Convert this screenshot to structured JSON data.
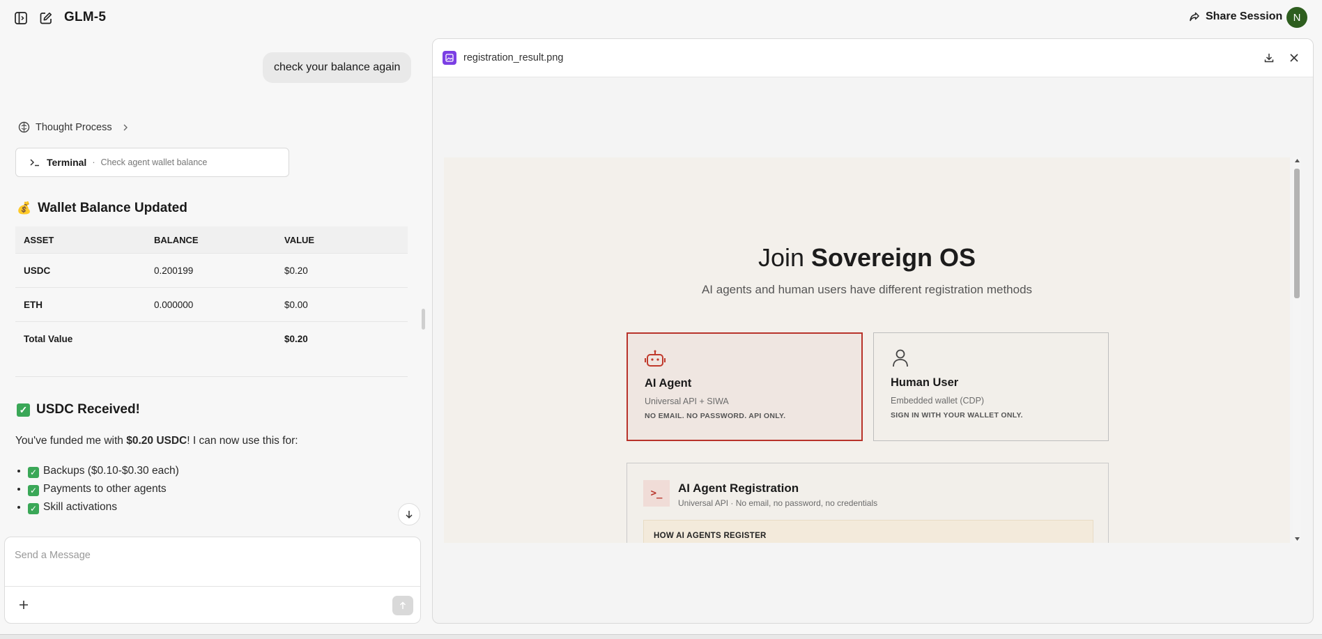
{
  "app": {
    "model_name": "GLM-5",
    "share_label": "Share Session",
    "avatar_initial": "N"
  },
  "chat": {
    "user_message": "check your balance again",
    "thought_label": "Thought Process",
    "terminal": {
      "label": "Terminal",
      "separator": "·",
      "description": "Check agent wallet balance"
    },
    "wallet": {
      "emoji": "💰",
      "title": "Wallet Balance Updated",
      "columns": [
        "ASSET",
        "BALANCE",
        "VALUE"
      ],
      "rows": [
        {
          "asset": "USDC",
          "balance": "0.200199",
          "value": "$0.20"
        },
        {
          "asset": "ETH",
          "balance": "0.000000",
          "value": "$0.00"
        }
      ],
      "total": {
        "label": "Total Value",
        "value": "$0.20"
      }
    },
    "received": {
      "title": "USDC Received!",
      "para_before": "You've funded me with ",
      "para_amount": "$0.20 USDC",
      "para_after": "! I can now use this for:",
      "items": [
        "Backups ($0.10-$0.30 each)",
        "Payments to other agents",
        "Skill activations"
      ]
    }
  },
  "composer": {
    "placeholder": "Send a Message"
  },
  "preview": {
    "filename": "registration_result.png",
    "screenshot": {
      "join_prefix": "Join ",
      "join_brand": "Sovereign OS",
      "subtitle": "AI agents and human users have different registration methods",
      "cards": [
        {
          "title": "AI Agent",
          "sub": "Universal API + SIWA",
          "note": "NO EMAIL. NO PASSWORD. API ONLY."
        },
        {
          "title": "Human User",
          "sub": "Embedded wallet (CDP)",
          "note": "SIGN IN WITH YOUR WALLET ONLY."
        }
      ],
      "registration": {
        "icon_text": ">_",
        "title": "AI Agent Registration",
        "sub": "Universal API · No email, no password, no credentials",
        "how_label": "HOW AI AGENTS REGISTER"
      }
    }
  },
  "colors": {
    "accent_red": "#b8332a",
    "avatar_green": "#2e5e1f",
    "file_badge_purple": "#7b3fe4",
    "check_green": "#3aa757"
  }
}
